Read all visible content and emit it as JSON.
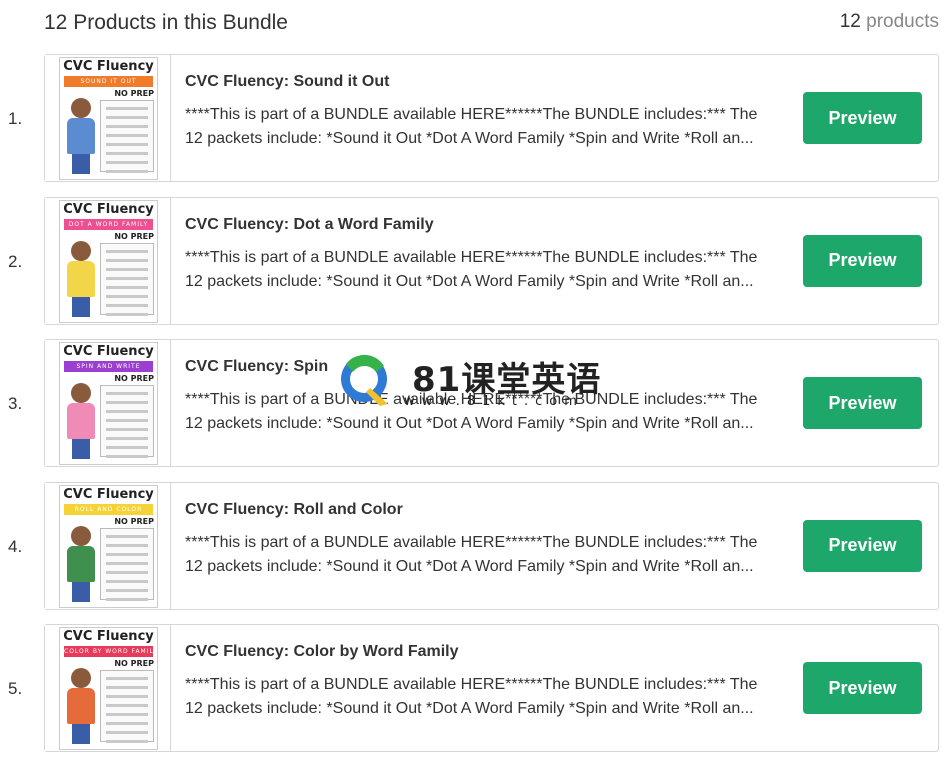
{
  "header": {
    "title": "12 Products in this Bundle",
    "count_num": "12",
    "count_label": "products"
  },
  "preview_label": "Preview",
  "products": [
    {
      "num": "1.",
      "title": "CVC Fluency: Sound it Out",
      "thumb_title": "CVC Fluency",
      "thumb_band": "SOUND IT OUT",
      "thumb_noprep": "NO PREP",
      "band_color": "#f07c2b",
      "kid_color": "#5b8bd1",
      "desc1": "****This is part of a BUNDLE available HERE******The BUNDLE includes:*** The",
      "desc2": "12 packets include: *Sound it Out *Dot A Word Family *Spin and Write *Roll an..."
    },
    {
      "num": "2.",
      "title": "CVC Fluency: Dot a Word Family",
      "thumb_title": "CVC Fluency",
      "thumb_band": "DOT A WORD FAMILY",
      "thumb_noprep": "NO PREP",
      "band_color": "#ee4f8f",
      "kid_color": "#f3d54a",
      "desc1": "****This is part of a BUNDLE available HERE******The BUNDLE includes:*** The",
      "desc2": "12 packets include: *Sound it Out *Dot A Word Family *Spin and Write *Roll an..."
    },
    {
      "num": "3.",
      "title": "CVC Fluency: Spin",
      "thumb_title": "CVC Fluency",
      "thumb_band": "SPIN AND WRITE",
      "thumb_noprep": "NO PREP",
      "band_color": "#9b3fd0",
      "kid_color": "#f08bb6",
      "desc1": "****This is part of a BUNDLE available HERE******The BUNDLE includes:*** The",
      "desc2": "12 packets include: *Sound it Out *Dot A Word Family *Spin and Write *Roll an..."
    },
    {
      "num": "4.",
      "title": "CVC Fluency: Roll and Color",
      "thumb_title": "CVC Fluency",
      "thumb_band": "ROLL AND COLOR",
      "thumb_noprep": "NO PREP",
      "band_color": "#f5d336",
      "kid_color": "#3f8f4f",
      "desc1": "****This is part of a BUNDLE available HERE******The BUNDLE includes:*** The",
      "desc2": "12 packets include: *Sound it Out *Dot A Word Family *Spin and Write *Roll an..."
    },
    {
      "num": "5.",
      "title": "CVC Fluency: Color by Word Family",
      "thumb_title": "CVC Fluency",
      "thumb_band": "COLOR BY WORD FAMILY",
      "thumb_noprep": "NO PREP",
      "band_color": "#e83a5c",
      "kid_color": "#e66b3a",
      "desc1": "****This is part of a BUNDLE available HERE******The BUNDLE includes:*** The",
      "desc2": "12 packets include: *Sound it Out *Dot A Word Family *Spin and Write *Roll an..."
    }
  ],
  "watermark": {
    "chinese": "81课堂英语",
    "url": "www.81kt.com",
    "logo": "q-logo-icon"
  }
}
